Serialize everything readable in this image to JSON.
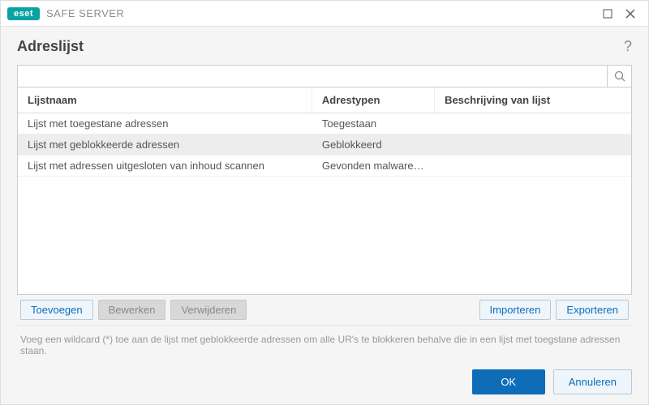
{
  "brand": {
    "badge": "eset",
    "product": "SAFE SERVER"
  },
  "page": {
    "title": "Adreslijst"
  },
  "search": {
    "value": "",
    "placeholder": ""
  },
  "table": {
    "headers": {
      "name": "Lijstnaam",
      "type": "Adrestypen",
      "desc": "Beschrijving van lijst"
    },
    "rows": [
      {
        "name": "Lijst met toegestane adressen",
        "type": "Toegestaan",
        "desc": "",
        "selected": false
      },
      {
        "name": "Lijst met geblokkeerde adressen",
        "type": "Geblokkeerd",
        "desc": "",
        "selected": true
      },
      {
        "name": "Lijst met adressen uitgesloten van inhoud scannen",
        "type": "Gevonden malware wor...",
        "desc": "",
        "selected": false
      }
    ]
  },
  "toolbar": {
    "add": "Toevoegen",
    "edit": "Bewerken",
    "delete": "Verwijderen",
    "import": "Importeren",
    "export": "Exporteren"
  },
  "hint": "Voeg een wildcard (*) toe aan de lijst met geblokkeerde adressen om alle UR's te blokkeren behalve die in een lijst met toegstane adressen staan.",
  "footer": {
    "ok": "OK",
    "cancel": "Annuleren"
  }
}
